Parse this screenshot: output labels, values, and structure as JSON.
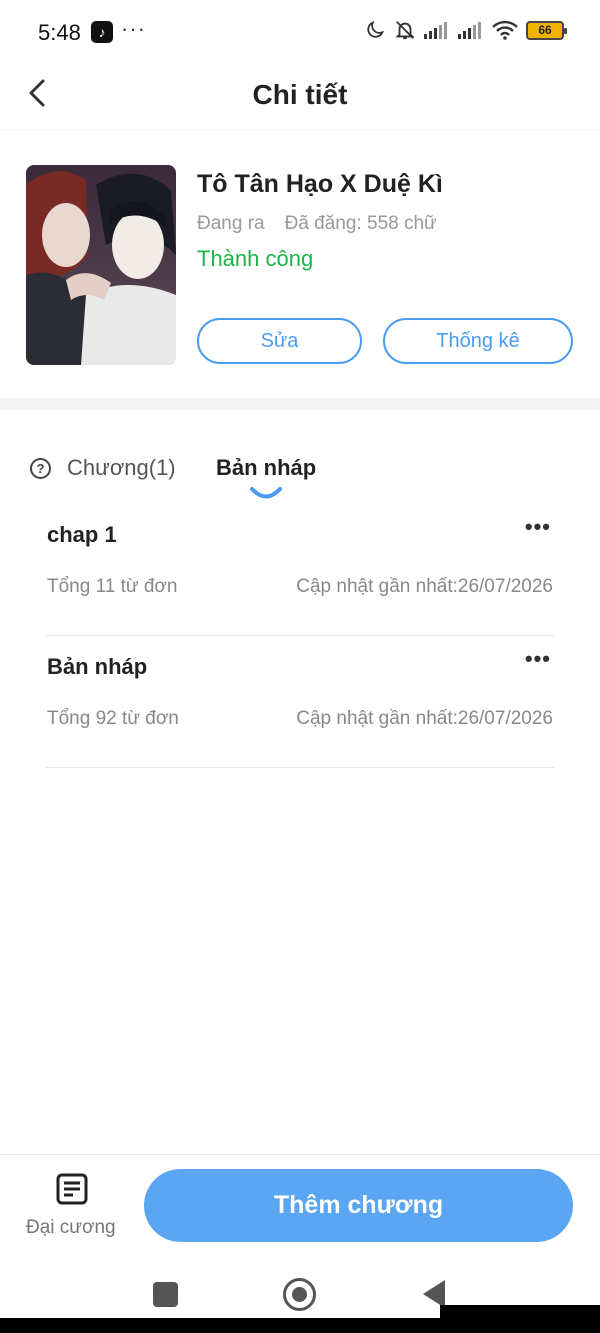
{
  "status_bar": {
    "time": "5:48",
    "app_icon": "tiktok-icon",
    "more": "···",
    "battery": "66",
    "icons": [
      "moon-icon",
      "bell-off-icon",
      "signal-icon",
      "signal-icon",
      "wifi-icon",
      "battery-icon"
    ]
  },
  "header": {
    "title": "Chi tiết",
    "back_icon": "back-arrow-icon"
  },
  "book": {
    "title": "Tô Tân Hạo X Duệ Kì",
    "status": "Đang ra",
    "word_count": "Đã đăng: 558 chữ",
    "state": "Thành công",
    "edit_label": "Sửa",
    "stats_label": "Thống kê"
  },
  "tabs": {
    "chapters": "Chương(1)",
    "drafts": "Bản nháp",
    "help_icon": "help-circle-icon"
  },
  "drafts": [
    {
      "title": "chap 1",
      "count": "Tổng 11 từ đơn",
      "updated": "Cập nhật gần nhất:26/07/2026"
    },
    {
      "title": "Bản nháp",
      "count": "Tổng 92 từ đơn",
      "updated": "Cập nhật gần nhất:26/07/2026"
    }
  ],
  "bottom": {
    "outline_label": "Đại cương",
    "add_label": "Thêm chương"
  },
  "colors": {
    "accent": "#5aa6f2",
    "success": "#1fb34a"
  }
}
